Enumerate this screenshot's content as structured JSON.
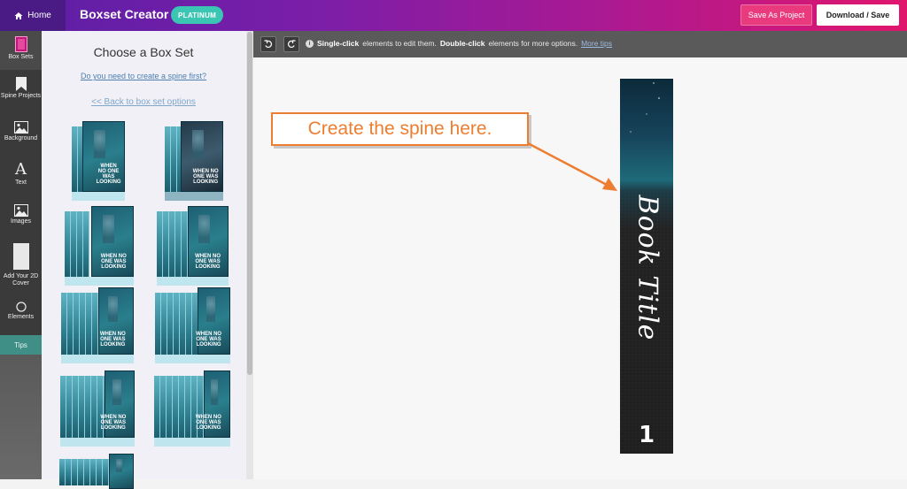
{
  "topbar": {
    "home_label": "Home",
    "app_title": "Boxset Creator",
    "plan_badge": "PLATINUM",
    "save_project_label": "Save As Project",
    "download_label": "Download / Save",
    "colors": {
      "gradient_start": "#5b1fa6",
      "gradient_end": "#e0166d",
      "badge": "#3bc6b4"
    }
  },
  "rail": {
    "items": [
      {
        "label": "Box Sets",
        "icon": "box-sets-icon",
        "active": true
      },
      {
        "label": "Spine Projects",
        "icon": "bookmark-icon",
        "active": false
      },
      {
        "label": "Background",
        "icon": "image-icon",
        "active": false
      },
      {
        "label": "Text",
        "icon": "text-icon",
        "active": false
      },
      {
        "label": "Images",
        "icon": "image-icon",
        "active": false
      },
      {
        "label": "Add Your 2D Cover",
        "icon": "cover-placeholder-icon",
        "active": false
      },
      {
        "label": "Elements",
        "icon": "circle-icon",
        "active": false
      }
    ],
    "tips_label": "Tips"
  },
  "panel": {
    "title": "Choose a Box Set",
    "spine_link": "Do you need to create a spine first?",
    "back_link": "<< Back to box set options",
    "boxsets": [
      {
        "text": "WHEN NO ONE WAS LOOKING",
        "volumes": 2
      },
      {
        "text": "WHEN NO ONE WAS LOOKING",
        "volumes": 3
      },
      {
        "text": "WHEN NO ONE WAS LOOKING",
        "volumes": 4
      },
      {
        "text": "WHEN NO ONE WAS LOOKING",
        "volumes": 5
      },
      {
        "text": "WHEN NO ONE WAS LOOKING",
        "volumes": 6
      },
      {
        "text": "WHEN NO ONE WAS LOOKING",
        "volumes": 7
      },
      {
        "text": "WHEN NO ONE WAS LOOKING",
        "volumes": 8
      },
      {
        "text": "WHEN NO ONE WAS LOOKING",
        "volumes": 9
      },
      {
        "text": "",
        "volumes": 10
      }
    ]
  },
  "toolbar": {
    "undo_icon": "undo-icon",
    "redo_icon": "redo-icon",
    "hint_bold1": "Single-click",
    "hint_text1": "elements to edit them.",
    "hint_bold2": "Double-click",
    "hint_text2": "elements for more options.",
    "hint_link": "More tips"
  },
  "canvas": {
    "spine_title": "Book Title",
    "spine_number": "1",
    "callout_text": "Create the spine here.",
    "callout_color": "#ed7d31"
  }
}
